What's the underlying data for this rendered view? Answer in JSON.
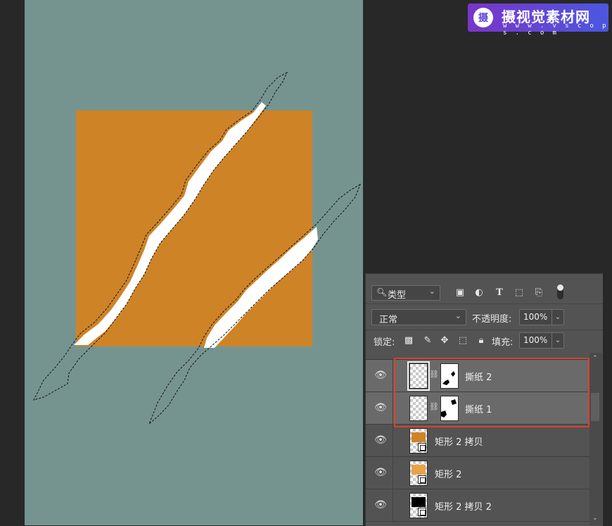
{
  "watermark": {
    "logo_char": "摄",
    "title": "摄视觉素材网",
    "url": "w w w . v s c o p s . c o m"
  },
  "canvas": {
    "background": "#76948f",
    "shape_color": "#cf8327"
  },
  "layers_panel": {
    "filter": {
      "icon": "search-icon",
      "label": "类型",
      "chevron": "⌄"
    },
    "filter_icons": [
      "image-filter-icon",
      "adjustment-filter-icon",
      "text-filter-icon",
      "shape-filter-icon",
      "smart-object-filter-icon"
    ],
    "blend_mode": "正常",
    "opacity": {
      "label": "不透明度:",
      "value": "100%"
    },
    "lock": {
      "label": "锁定:"
    },
    "fill": {
      "label": "填充:",
      "value": "100%"
    },
    "layers": [
      {
        "name": "撕纸 2",
        "selected": true,
        "has_mask": true
      },
      {
        "name": "撕纸 1",
        "selected": true,
        "has_mask": true
      },
      {
        "name": "矩形 2 拷贝",
        "selected": false,
        "shape_color": "#cf8327"
      },
      {
        "name": "矩形 2",
        "selected": false,
        "shape_color": "#e8a24a"
      },
      {
        "name": "矩形 2 拷贝 2",
        "selected": false,
        "shape_color": "#000000"
      }
    ]
  },
  "highlight_color": "#d9432e"
}
